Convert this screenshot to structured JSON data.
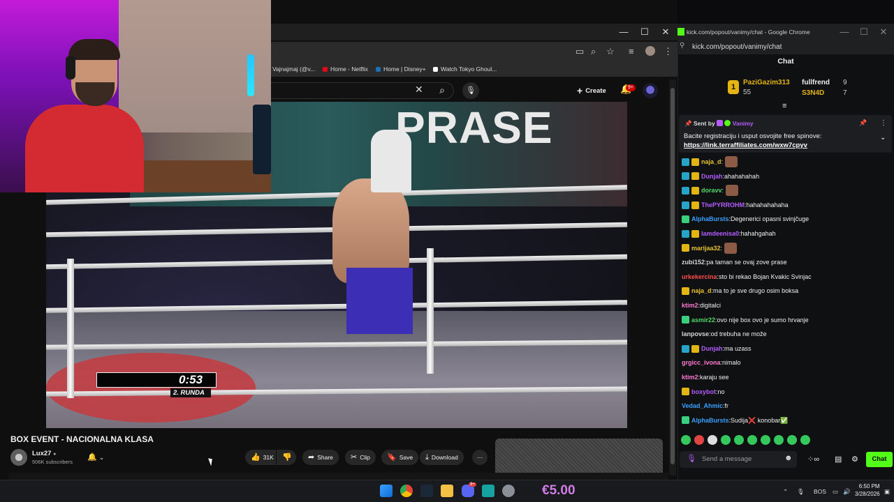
{
  "youtube": {
    "bookmarks": [
      "Vajnajmaj (@v...",
      "Home - Netflix",
      "Home | Disney+",
      "Watch Tokyo Ghoul..."
    ],
    "create_label": "Create",
    "notif_badge": "9+",
    "video_overlay": {
      "banner_text": "PRASE",
      "timer": "0:53",
      "round": "2. RUNDA"
    },
    "video_title": "BOX EVENT - NACIONALNA KLASA",
    "channel": {
      "name": "Lux27",
      "subscribers": "506K subscribers"
    },
    "actions": {
      "likes": "31K",
      "share": "Share",
      "clip": "Clip",
      "save": "Save",
      "download": "Download"
    }
  },
  "chat_window": {
    "title": "kick.com/popout/vanimy/chat - Google Chrome",
    "url": "kick.com/popout/vanimy/chat",
    "header": "Chat",
    "leaderboard": [
      {
        "rank": "1",
        "name": "PaziGazim313",
        "count": "55"
      },
      {
        "rank": "",
        "name": "fullfrend",
        "count": "9"
      },
      {
        "rank": "",
        "name": "S3N4D",
        "count": "7"
      }
    ],
    "pinned": {
      "sent_by_label": "Sent by",
      "sender": "Vanimy",
      "text": "Bacite registraciju i usput osvojite free spinove:",
      "link": "https://link.terraffiliates.com/wxw7cpyv"
    },
    "messages": [
      {
        "user": "naja_d",
        "color": "#e7c234",
        "badges": [
          "cyan",
          "gold"
        ],
        "text": "",
        "emote": true
      },
      {
        "user": "Dunjah",
        "color": "#b45cff",
        "badges": [
          "cyan",
          "gold"
        ],
        "text": "ahahahahah",
        "emote": false
      },
      {
        "user": "doravv",
        "color": "#53d86a",
        "badges": [
          "cyan",
          "gold"
        ],
        "text": "",
        "emote": true
      },
      {
        "user": "ThePYRROHM",
        "color": "#b45cff",
        "badges": [
          "cyan",
          "gold"
        ],
        "text": "hahahahahaha",
        "emote": false
      },
      {
        "user": "AlphaBursts",
        "color": "#3aa0ff",
        "badges": [
          "green"
        ],
        "text": "Degenerici opasni svinjčuge",
        "emote": false
      },
      {
        "user": "lamdeenisa0",
        "color": "#b45cff",
        "badges": [
          "cyan",
          "gold"
        ],
        "text": "hahahgahah",
        "emote": false
      },
      {
        "user": "marijaa32",
        "color": "#e7c234",
        "badges": [
          "gold"
        ],
        "text": "",
        "emote": true
      },
      {
        "user": "zubi152",
        "color": "#d6d6d6",
        "badges": [],
        "text": "pa taman se ovaj zove prase",
        "emote": false
      },
      {
        "user": "urkekercina",
        "color": "#ff4d4d",
        "badges": [],
        "text": "sto bi rekao Bojan Kvakic Svinjac",
        "emote": false
      },
      {
        "user": "naja_d",
        "color": "#e7c234",
        "badges": [
          "gold"
        ],
        "text": "ma to je sve drugo osim boksa",
        "emote": false
      },
      {
        "user": "ktim2",
        "color": "#ff7ad1",
        "badges": [],
        "text": "digitalci",
        "emote": false
      },
      {
        "user": "asmir22",
        "color": "#53d86a",
        "badges": [
          "green"
        ],
        "text": "ovo nije box ovo je sumo hrvanje",
        "emote": false
      },
      {
        "user": "lanpovse",
        "color": "#d6d6d6",
        "badges": [],
        "text": "od trebuha ne može",
        "emote": false
      },
      {
        "user": "Dunjah",
        "color": "#b45cff",
        "badges": [
          "cyan",
          "gold"
        ],
        "text": "ma uzass",
        "emote": false
      },
      {
        "user": "grgicc_ivona",
        "color": "#ff7ad1",
        "badges": [],
        "text": "nimalo",
        "emote": false
      },
      {
        "user": "ktim2",
        "color": "#ff7ad1",
        "badges": [],
        "text": "karaju see",
        "emote": false
      },
      {
        "user": "boxybot",
        "color": "#b45cff",
        "badges": [
          "gold"
        ],
        "text": "no",
        "emote": false
      },
      {
        "user": "Vedad_Ahmic",
        "color": "#3aa0ff",
        "badges": [],
        "text": "fr",
        "emote": false
      },
      {
        "user": "AlphaBursts",
        "color": "#3aa0ff",
        "badges": [
          "green"
        ],
        "text": "Sudija❌ konobar✅",
        "emote": false
      }
    ],
    "input_placeholder": "Send a message",
    "chat_button": "Chat"
  },
  "taskbar": {
    "overlay_amount": "€5.00",
    "discord_badge": "9+",
    "tray_language": "BOS",
    "time": "6:50 PM",
    "date": "3/28/2026"
  }
}
